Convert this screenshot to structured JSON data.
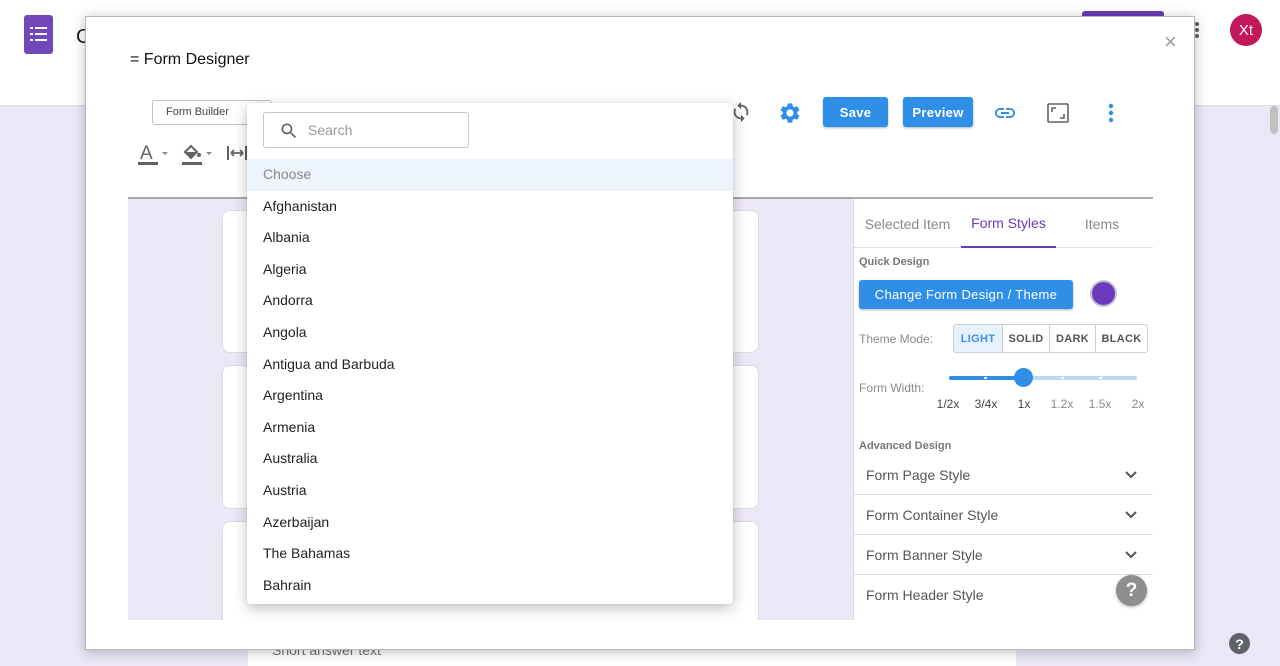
{
  "background": {
    "app_letter": "C",
    "avatar_initials": "Xt",
    "help_symbol": "?",
    "short_answer_text": "Short answer text"
  },
  "modal": {
    "title": "= Form Designer",
    "close_symbol": "×"
  },
  "toolbar": {
    "mode_select": "Form Builder",
    "save_label": "Save",
    "preview_label": "Preview"
  },
  "dropdown": {
    "search_placeholder": "Search",
    "placeholder_option": "Choose",
    "options": [
      "Afghanistan",
      "Albania",
      "Algeria",
      "Andorra",
      "Angola",
      "Antigua and Barbuda",
      "Argentina",
      "Armenia",
      "Australia",
      "Austria",
      "Azerbaijan",
      "The Bahamas",
      "Bahrain"
    ]
  },
  "panel": {
    "tabs": [
      "Selected Item",
      "Form Styles",
      "Items"
    ],
    "active_tab": "Form Styles",
    "quick_design_label": "Quick Design",
    "change_theme_label": "Change Form Design / Theme",
    "theme_color": "#6b3bbf",
    "theme_mode_label": "Theme Mode:",
    "theme_modes": [
      "LIGHT",
      "SOLID",
      "DARK",
      "BLACK"
    ],
    "active_theme_mode": "LIGHT",
    "form_width_label": "Form Width:",
    "width_options": [
      "1/2x",
      "3/4x",
      "1x",
      "1.2x",
      "1.5x",
      "2x"
    ],
    "selected_width": "1x",
    "advanced_design_label": "Advanced Design",
    "advanced_items": [
      "Form Page Style",
      "Form Container Style",
      "Form Banner Style",
      "Form Header Style"
    ],
    "help_symbol": "?"
  },
  "colors": {
    "accent_blue": "#2f8fe6",
    "accent_purple": "#6a3bb7",
    "canvas_bg": "#ece7f6"
  }
}
